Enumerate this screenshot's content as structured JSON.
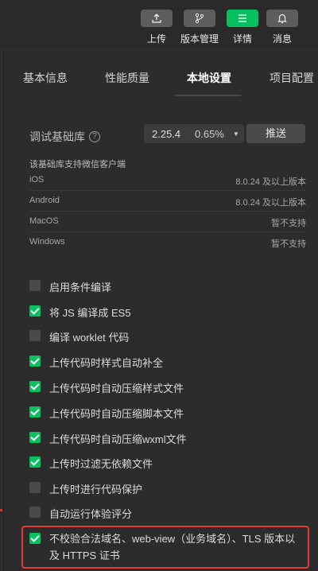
{
  "toolbar": {
    "buttons": [
      {
        "label": "上传",
        "icon": "upload-icon",
        "active": false
      },
      {
        "label": "版本管理",
        "icon": "branch-icon",
        "active": false
      },
      {
        "label": "详情",
        "icon": "list-icon",
        "active": true
      },
      {
        "label": "消息",
        "icon": "bell-icon",
        "active": false
      }
    ]
  },
  "tabs": [
    "基本信息",
    "性能质量",
    "本地设置",
    "项目配置"
  ],
  "active_tab": "本地设置",
  "lib": {
    "label": "调试基础库",
    "help": "?",
    "version": "2.25.4",
    "percent": "0.65%",
    "push_label": "推送"
  },
  "support": {
    "caption": "该基础库支持微信客户端",
    "rows": [
      {
        "os": "iOS",
        "version": "8.0.24 及以上版本"
      },
      {
        "os": "Android",
        "version": "8.0.24 及以上版本"
      },
      {
        "os": "MacOS",
        "version": "暂不支持"
      },
      {
        "os": "Windows",
        "version": "暂不支持"
      }
    ]
  },
  "options": [
    {
      "label": "启用条件编译",
      "checked": false
    },
    {
      "label": "将 JS 编译成 ES5",
      "checked": true
    },
    {
      "label": "编译 worklet 代码",
      "checked": false
    },
    {
      "label": "上传代码时样式自动补全",
      "checked": true
    },
    {
      "label": "上传代码时自动压缩样式文件",
      "checked": true
    },
    {
      "label": "上传代码时自动压缩脚本文件",
      "checked": true
    },
    {
      "label": "上传代码时自动压缩wxml文件",
      "checked": true
    },
    {
      "label": "上传时过滤无依赖文件",
      "checked": true
    },
    {
      "label": "上传时进行代码保护",
      "checked": false
    },
    {
      "label": "自动运行体验评分",
      "checked": false
    },
    {
      "label": "不校验合法域名、web-view（业务域名）、TLS 版本以及 HTTPS 证书",
      "checked": true
    }
  ],
  "colors": {
    "accent": "#07c160",
    "highlight": "#e53935"
  }
}
